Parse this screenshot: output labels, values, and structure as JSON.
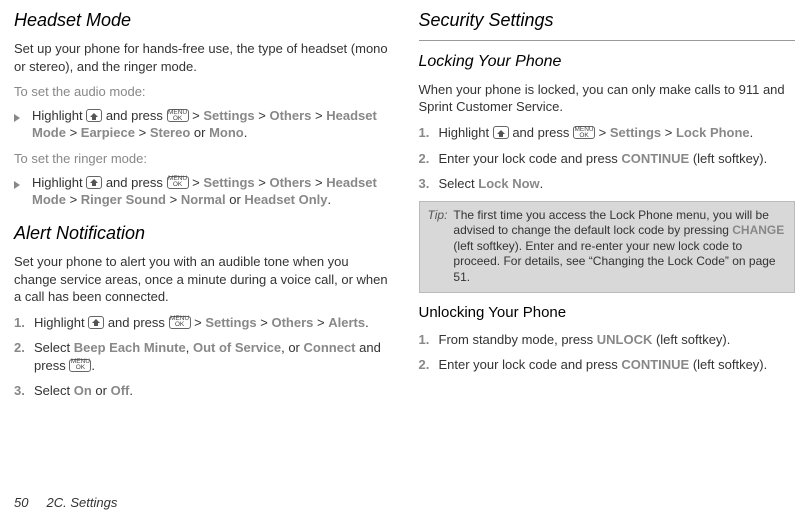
{
  "left": {
    "heading1": "Headset Mode",
    "intro1": "Set up your phone for hands-free use, the type of headset (mono or stereo), and the ringer mode.",
    "audioLabel": "To set the audio mode:",
    "audio_pre": "Highlight ",
    "audio_mid": " and press ",
    "audio_gt1": " > ",
    "audio_settings": "Settings",
    "audio_others": "Others",
    "audio_hmode": "Headset Mode",
    "audio_earpiece": "Earpiece",
    "audio_stereo": "Stereo",
    "audio_or": " or ",
    "audio_mono": "Mono",
    "audio_dot": ".",
    "ringerLabel": "To set the ringer mode:",
    "ringer_rsound": "Ringer Sound",
    "ringer_normal": "Normal",
    "ringer_or": " or ",
    "ringer_honly": "Headset Only",
    "heading2": "Alert Notification",
    "intro2": "Set your phone to alert you with an audible tone when you change service areas, once a minute during a voice call, or when a call has been connected.",
    "s1_hl": "Highlight ",
    "s1_andpress": " and press ",
    "s1_settings": "Settings",
    "s1_others": "Others",
    "s1_alerts": "Alerts",
    "s2_select": "Select ",
    "s2_beep": "Beep Each Minute",
    "s2_c": ", ",
    "s2_oos": "Out of Service",
    "s2_cor": ", or ",
    "s2_connect": "Connect",
    "s2_andpress": " and press ",
    "s3_select": "Select ",
    "s3_on": "On",
    "s3_or": " or ",
    "s3_off": "Off",
    "footerPage": "50",
    "footerSection": "2C. Settings"
  },
  "right": {
    "heading": "Security Settings",
    "sub1": "Locking Your Phone",
    "intro": "When your phone is locked, you can only make calls to 911 and Sprint Customer Service.",
    "r1_hl": "Highlight ",
    "r1_andpress": " and press ",
    "r1_settings": "Settings",
    "r1_lockphone": "Lock Phone",
    "r2a": "Enter your lock code and press ",
    "r2_continue": "CONTINUE",
    "r2b": " (left softkey).",
    "r3a": "Select ",
    "r3_locknow": "Lock Now",
    "tipLabel": "Tip:",
    "tipText1": "The first time you access the Lock Phone menu, you will be advised to change the default lock code by pressing ",
    "tip_change": "CHANGE",
    "tipText2": " (left softkey). Enter and re-enter your new lock code to proceed. For details, see “Changing the Lock Code” on page 51.",
    "sub2": "Unlocking Your Phone",
    "u1a": "From standby mode, press ",
    "u1_unlock": "UNLOCK",
    "u1b": " (left softkey).",
    "u2a": "Enter your lock code and press ",
    "u2_continue": "CONTINUE",
    "u2b": " (left softkey).",
    "num1": "1.",
    "num2": "2.",
    "num3": "3."
  },
  "common": {
    "gt": " > "
  }
}
